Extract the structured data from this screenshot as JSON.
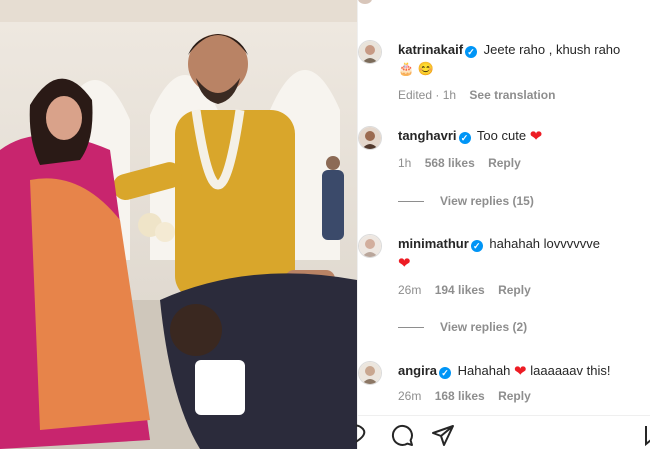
{
  "comments": [
    {
      "username": "katrinakaif",
      "text": "Jeete raho , khush raho",
      "emojis": "🎂 😊",
      "meta": {
        "time": "Edited · 1h",
        "action": "See translation"
      }
    },
    {
      "username": "tanghavri",
      "text": "Too cute",
      "meta": {
        "time": "1h",
        "likes": "568 likes",
        "reply": "Reply"
      },
      "view_replies": "View replies (15)"
    },
    {
      "username": "minimathur",
      "text": "hahahah lovvvvvve",
      "meta": {
        "time": "26m",
        "likes": "194 likes",
        "reply": "Reply"
      },
      "view_replies": "View replies (2)"
    },
    {
      "username": "angira",
      "text": "Hahahah",
      "text_after": "laaaaaav this!",
      "meta": {
        "time": "26m",
        "likes": "168 likes",
        "reply": "Reply"
      }
    }
  ],
  "icons": {
    "like": "heart-outline-icon",
    "comment": "comment-bubble-icon",
    "share": "paper-plane-icon",
    "save": "bookmark-icon"
  },
  "colors": {
    "verified": "#0095f6",
    "heart": "#ed1c24",
    "muted": "#8e8e8e"
  }
}
